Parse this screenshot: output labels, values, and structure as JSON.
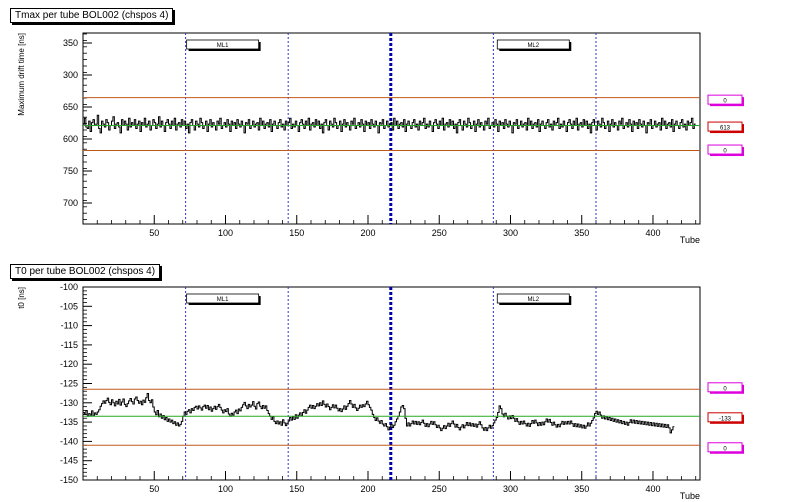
{
  "chart_data": [
    {
      "type": "line",
      "title": "Tmax per tube BOL002 (chspos 4)",
      "xlabel": "Tube",
      "ylabel": "Maximum drift time [ns]",
      "xlim": [
        0,
        433
      ],
      "ylim": [
        680,
        550
      ],
      "x_ticks": [
        50,
        100,
        150,
        200,
        250,
        300,
        350,
        400
      ],
      "y_ticks": [
        550,
        500,
        650,
        600,
        750,
        700
      ],
      "y_tick_labels": [
        "350",
        "300",
        "650",
        "600",
        "750",
        "700"
      ],
      "mean": 613,
      "upper_ref": 630,
      "lower_ref": 594,
      "mean_label": "613",
      "upper_label": "0",
      "lower_label": "0",
      "region_labels": [
        "ML1",
        "ML2"
      ],
      "region_label_x": [
        98,
        316
      ],
      "dashed_lines_x": [
        72,
        144,
        216,
        288,
        360
      ],
      "multilayer_boundary_x": 216,
      "series": [
        {
          "values": [
            612,
            608,
            614,
            615,
            610,
            617,
            611,
            609,
            613,
            612,
            606,
            615,
            618,
            610,
            612,
            614,
            609,
            611,
            616,
            613,
            610,
            607,
            615,
            612,
            611,
            614,
            618,
            609,
            613,
            610,
            612,
            616,
            608,
            614,
            611,
            613,
            609,
            615,
            612,
            610,
            617,
            611,
            613,
            608,
            614,
            612,
            610,
            616,
            613,
            609,
            611,
            615,
            612,
            607,
            614,
            610,
            613,
            617,
            611,
            609,
            612,
            615,
            610,
            613,
            608,
            616,
            612,
            611,
            614,
            609,
            613,
            610,
            615,
            612,
            618,
            611,
            609,
            613,
            616,
            610,
            612,
            614,
            608,
            611,
            615,
            613,
            610,
            617,
            612,
            609,
            614,
            611,
            613,
            616,
            610,
            612,
            608,
            615,
            613,
            611,
            614,
            609,
            612,
            617,
            610,
            613,
            611,
            615,
            609,
            612,
            614,
            610,
            613,
            618,
            611,
            612,
            609,
            615,
            613,
            610,
            614,
            612,
            611,
            616,
            608,
            613,
            610,
            615,
            612,
            611,
            614,
            609,
            617,
            612,
            610,
            613,
            615,
            611,
            609,
            614,
            612,
            616,
            610,
            613,
            611,
            608,
            615,
            612,
            614,
            610,
            613,
            617,
            611,
            609,
            612,
            615,
            610,
            613,
            608,
            616,
            612,
            611,
            614,
            609,
            613,
            610,
            615,
            612,
            618,
            611,
            609,
            613,
            616,
            610,
            612,
            614,
            608,
            611,
            615,
            613,
            610,
            617,
            612,
            609,
            614,
            611,
            613,
            616,
            610,
            612,
            608,
            615,
            613,
            611,
            614,
            609,
            612,
            617,
            610,
            613,
            611,
            615,
            609,
            612,
            614,
            610,
            613,
            618,
            611,
            612,
            609,
            615,
            613,
            610,
            614,
            612,
            611,
            616,
            608,
            613,
            610,
            615,
            612,
            611,
            614,
            609,
            617,
            612,
            610,
            613,
            615,
            611,
            609,
            614,
            612,
            616,
            610,
            613,
            611,
            608,
            615,
            612,
            614,
            610,
            613,
            617,
            611,
            609,
            612,
            615,
            610,
            613,
            608,
            616,
            612,
            611,
            614,
            609,
            613,
            610,
            615,
            612,
            618,
            611,
            609,
            613,
            616,
            610,
            612,
            614,
            608,
            611,
            615,
            613,
            610,
            617,
            612,
            609,
            614,
            611,
            613,
            616,
            610,
            612,
            608,
            615,
            613,
            611,
            614,
            609,
            612,
            617,
            610,
            613,
            611,
            615,
            609,
            612,
            614,
            610,
            613,
            618,
            611,
            612,
            609,
            615,
            613,
            610,
            614,
            612,
            611,
            616,
            608,
            613,
            610,
            615,
            612,
            611,
            614,
            609,
            617,
            612,
            610,
            613,
            615,
            611,
            609,
            614,
            612,
            616,
            610,
            613,
            611,
            608,
            615,
            612,
            614,
            610,
            613,
            617,
            611,
            609,
            612,
            615,
            610,
            613,
            608,
            616,
            612,
            611,
            614,
            609,
            613,
            610,
            615,
            612,
            618,
            611,
            609,
            613,
            616,
            610,
            612,
            614,
            608,
            611,
            615,
            613,
            610,
            617,
            612,
            609,
            614,
            611,
            613,
            616,
            610,
            612,
            608,
            615,
            613,
            611,
            614,
            609,
            612,
            617,
            610,
            613,
            611,
            615,
            609,
            612,
            614,
            610,
            613,
            618,
            611,
            612,
            609,
            615,
            613,
            610,
            614,
            612,
            611,
            616,
            608,
            613,
            610,
            615,
            612,
            611,
            614,
            609,
            617,
            612,
            610,
            613,
            615,
            611,
            609,
            614,
            612,
            616,
            610,
            613,
            611,
            608,
            615,
            612
          ]
        }
      ]
    },
    {
      "type": "line",
      "title": "T0 per tube BOL002 (chspos 4)",
      "xlabel": "Tube",
      "ylabel": "t0 [ns]",
      "xlim": [
        0,
        433
      ],
      "ylim": [
        -150,
        -100
      ],
      "x_ticks": [
        50,
        100,
        150,
        200,
        250,
        300,
        350,
        400
      ],
      "y_ticks": [
        -100,
        -105,
        -110,
        -115,
        -120,
        -125,
        -130,
        -135,
        -140,
        -145,
        -150
      ],
      "mean": -133.5,
      "upper_ref": -126.5,
      "lower_ref": -141.0,
      "mean_label": "-133",
      "upper_label": "0",
      "lower_label": "0",
      "region_labels": [
        "ML1",
        "ML2"
      ],
      "region_label_x": [
        98,
        316
      ],
      "dashed_lines_x": [
        72,
        144,
        216,
        288,
        360
      ],
      "multilayer_boundary_x": 216,
      "series": [
        {
          "values": [
            -132.5,
            -133.0,
            -132.0,
            -133.5,
            -132.8,
            -133.2,
            -132.1,
            -133.4,
            -132.6,
            -133.0,
            -132.4,
            -131.8,
            -130.9,
            -130.2,
            -129.5,
            -130.1,
            -129.4,
            -128.8,
            -129.9,
            -130.5,
            -129.2,
            -130.0,
            -130.8,
            -129.6,
            -130.3,
            -129.1,
            -130.6,
            -129.8,
            -129.0,
            -130.4,
            -131.0,
            -130.2,
            -129.5,
            -128.9,
            -129.7,
            -130.3,
            -129.0,
            -128.5,
            -129.4,
            -130.1,
            -129.6,
            -130.5,
            -129.3,
            -129.9,
            -128.7,
            -127.6,
            -129.4,
            -130.0,
            -129.2,
            -131.1,
            -132.4,
            -133.1,
            -132.0,
            -133.6,
            -132.9,
            -134.0,
            -133.3,
            -134.4,
            -133.8,
            -134.8,
            -134.2,
            -135.0,
            -134.5,
            -135.4,
            -134.9,
            -135.8,
            -135.2,
            -136.0,
            -135.6,
            -134.8,
            -133.5,
            -132.4,
            -133.0,
            -132.2,
            -131.8,
            -132.6,
            -131.5,
            -132.0,
            -131.2,
            -130.9,
            -131.6,
            -130.8,
            -131.3,
            -131.9,
            -131.0,
            -130.6,
            -131.4,
            -130.7,
            -131.8,
            -131.1,
            -132.2,
            -131.5,
            -130.9,
            -131.7,
            -131.0,
            -130.4,
            -131.2,
            -131.9,
            -132.6,
            -131.8,
            -132.3,
            -131.5,
            -132.9,
            -133.5,
            -132.7,
            -133.2,
            -132.4,
            -131.9,
            -132.8,
            -131.6,
            -132.1,
            -131.2,
            -130.5,
            -129.9,
            -130.8,
            -131.5,
            -130.4,
            -131.1,
            -130.6,
            -129.7,
            -130.9,
            -131.6,
            -130.2,
            -129.8,
            -130.9,
            -131.5,
            -130.7,
            -131.4,
            -130.8,
            -132.0,
            -132.8,
            -133.5,
            -134.3,
            -133.6,
            -134.8,
            -135.4,
            -134.7,
            -135.5,
            -134.9,
            -135.8,
            -134.4,
            -135.2,
            -135.9,
            -135.3,
            -134.7,
            -133.8,
            -134.5,
            -133.6,
            -134.3,
            -133.1,
            -134.0,
            -133.2,
            -132.6,
            -133.4,
            -132.5,
            -131.8,
            -132.7,
            -131.9,
            -131.2,
            -130.6,
            -131.4,
            -130.7,
            -131.5,
            -130.9,
            -130.2,
            -130.8,
            -130.0,
            -130.7,
            -129.5,
            -130.4,
            -131.1,
            -130.3,
            -131.0,
            -131.8,
            -131.2,
            -130.5,
            -131.3,
            -130.6,
            -131.4,
            -132.1,
            -131.5,
            -132.3,
            -131.6,
            -130.8,
            -131.7,
            -130.9,
            -130.2,
            -129.4,
            -130.3,
            -131.2,
            -130.4,
            -131.3,
            -132.0,
            -131.4,
            -130.6,
            -131.2,
            -130.5,
            -131.0,
            -130.3,
            -129.6,
            -130.5,
            -131.2,
            -131.9,
            -133.0,
            -133.8,
            -134.6,
            -133.9,
            -134.7,
            -135.3,
            -134.6,
            -135.5,
            -136.0,
            -135.4,
            -136.2,
            -137.0,
            -136.3,
            -135.6,
            -136.4,
            -135.8,
            -134.9,
            -134.2,
            -133.5,
            -132.4,
            -131.1,
            -130.7,
            -131.5,
            -134.0,
            -136.0,
            -135.2,
            -136.0,
            -135.4,
            -134.7,
            -135.5,
            -134.8,
            -135.6,
            -134.9,
            -135.7,
            -135.1,
            -134.5,
            -135.3,
            -136.1,
            -135.4,
            -136.2,
            -135.5,
            -134.8,
            -135.6,
            -134.9,
            -135.7,
            -136.4,
            -135.8,
            -136.5,
            -137.2,
            -136.6,
            -135.9,
            -136.7,
            -136.0,
            -135.3,
            -136.1,
            -135.4,
            -134.7,
            -135.5,
            -136.3,
            -135.6,
            -136.4,
            -137.0,
            -136.3,
            -135.7,
            -136.5,
            -135.8,
            -135.1,
            -135.9,
            -135.2,
            -136.0,
            -135.4,
            -136.1,
            -135.5,
            -136.3,
            -135.6,
            -134.9,
            -135.7,
            -136.5,
            -137.1,
            -136.4,
            -137.2,
            -136.5,
            -135.8,
            -136.6,
            -135.9,
            -135.2,
            -134.5,
            -133.8,
            -132.5,
            -130.8,
            -131.5,
            -132.9,
            -133.6,
            -132.7,
            -133.5,
            -134.2,
            -133.4,
            -134.1,
            -133.3,
            -134.0,
            -134.8,
            -134.1,
            -134.9,
            -135.6,
            -134.8,
            -135.5,
            -134.7,
            -135.4,
            -136.0,
            -135.3,
            -136.1,
            -135.4,
            -134.6,
            -135.3,
            -134.5,
            -135.2,
            -135.9,
            -135.1,
            -135.8,
            -135.0,
            -135.7,
            -134.9,
            -134.2,
            -135.0,
            -134.3,
            -135.1,
            -135.8,
            -135.0,
            -135.7,
            -136.3,
            -135.6,
            -136.2,
            -135.5,
            -134.8,
            -135.6,
            -134.9,
            -135.5,
            -134.8,
            -135.5,
            -134.7,
            -135.4,
            -136.1,
            -135.4,
            -136.2,
            -135.5,
            -136.3,
            -135.7,
            -136.5,
            -135.8,
            -136.6,
            -136.0,
            -135.2,
            -136.0,
            -135.3,
            -134.6,
            -133.9,
            -132.8,
            -132.2,
            -133.0,
            -132.4,
            -133.2,
            -134.0,
            -133.4,
            -134.2,
            -133.6,
            -134.4,
            -133.8,
            -134.6,
            -134.0,
            -134.8,
            -134.2,
            -135.0,
            -134.4,
            -135.2,
            -134.6,
            -135.4,
            -134.8,
            -135.6,
            -135.0,
            -135.8,
            -135.1,
            -134.4,
            -135.2,
            -134.5,
            -135.3,
            -134.6,
            -135.4,
            -134.7,
            -135.5,
            -134.8,
            -135.6,
            -134.9,
            -135.7,
            -135.0,
            -135.8,
            -135.1,
            -135.9,
            -135.2,
            -136.0,
            -135.3,
            -136.1,
            -135.4,
            -136.2,
            -135.5,
            -136.3,
            -135.6,
            -136.4,
            -135.7,
            -136.5,
            -137.8,
            -137.0,
            -136.2
          ]
        }
      ]
    }
  ]
}
